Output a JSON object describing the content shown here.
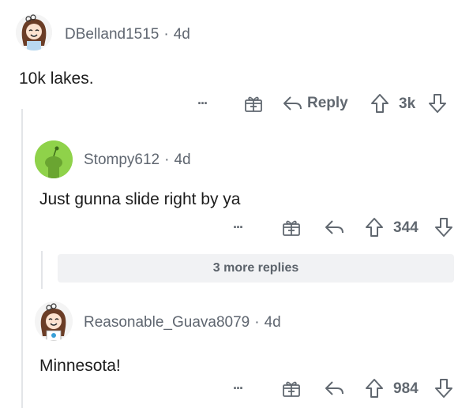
{
  "comments": [
    {
      "author": "DBelland1515",
      "sep": "·",
      "age": "4d",
      "body": "10k lakes.",
      "reply_label": "Reply",
      "score": "3k",
      "more": "···"
    },
    {
      "author": "Stompy612",
      "sep": "·",
      "age": "4d",
      "body": "Just gunna slide right by ya",
      "score": "344",
      "more": "···"
    },
    {
      "author": "Reasonable_Guava8079",
      "sep": "·",
      "age": "4d",
      "body": "Minnesota!",
      "score": "984",
      "more": "···"
    }
  ],
  "more_replies": {
    "label": "3 more replies"
  },
  "icons": {
    "gift": "gift-icon",
    "reply": "reply-arrow-icon",
    "upvote": "upvote-arrow-icon",
    "downvote": "downvote-arrow-icon",
    "more": "more-dots-icon"
  },
  "colors": {
    "action_gray": "#616870",
    "meta_gray": "#5f6670",
    "more_replies_bg": "#f1f2f4",
    "snoo_green": "#8fd24a"
  }
}
